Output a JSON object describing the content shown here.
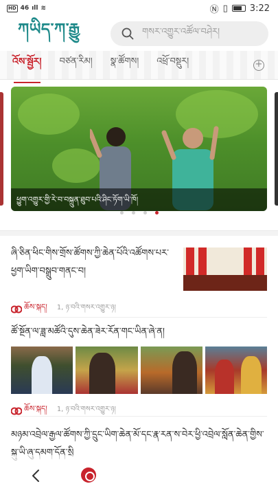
{
  "status_bar": {
    "left": [
      "HD",
      "46",
      "ıll",
      "≋"
    ],
    "icons": [
      "nfc-icon",
      "vibrate-icon",
      "battery-icon"
    ],
    "time": "3:22"
  },
  "header": {
    "logo": "ཀཡིད་ཀ་རྒྱུ",
    "search_placeholder": "གསར་འགྱུར་འཚོལ་བཤེར།"
  },
  "tabs": [
    {
      "label": "འོས་སྦྱོར།",
      "active": true
    },
    {
      "label": "བཙན་རིམ།",
      "active": false
    },
    {
      "label": "སྣ་ཚོགས།",
      "active": false
    },
    {
      "label": "འཕྲོ་བསྡུར།",
      "active": false
    }
  ],
  "banner": {
    "caption": "ཕྱུག་འགྱུར་གྱི་རེ་བ་བསྐྲུན་ཐུབ་པའི་ཤིང་ཏོག་ཡི་ཁོ།",
    "slides": 4,
    "active_slide": 4
  },
  "articles": [
    {
      "title": "ཞི་ཅིན་ཕིང་གིས་གྲོས་ཚོགས་ཀྱི་ཆེན་པོའི་འཚོགས་པར་ཕྱག་ཡིག་བསྒྲུབ་གནང་བ།",
      "source": "ཆོས་སྐད།",
      "time": "1, ཉ་བའི་གསར་འགྱུར་ཉ།"
    },
    {
      "title": "ཚོ་སྔོན་ལ་ཟླ་མཚོའི་དུས་ཆེན་ཟེར་རོན་གང་ཡིན་ཞེ་ན།",
      "source": "ཆོས་སྐད།",
      "time": "1, ཉ་བའི་གསར་འགྱུར་ཉ།"
    },
    {
      "title": "མཉམ་འབྲེལ་རྒྱལ་ཚོགས་ཀྱི་དྲུང་ཡིག་ཆེན་མོ་དང་རྣ་རན་ས་བེར་ཕྱི་འབྲེལ་སློན་ཆེན་གྱིས་སྐུ་ཡི་ཞུ་དམག་དོན་སྲི"
    }
  ],
  "colors": {
    "accent": "#c8232c",
    "logo_teal": "#1f8a8a",
    "logo_gold": "#d59b1c"
  }
}
